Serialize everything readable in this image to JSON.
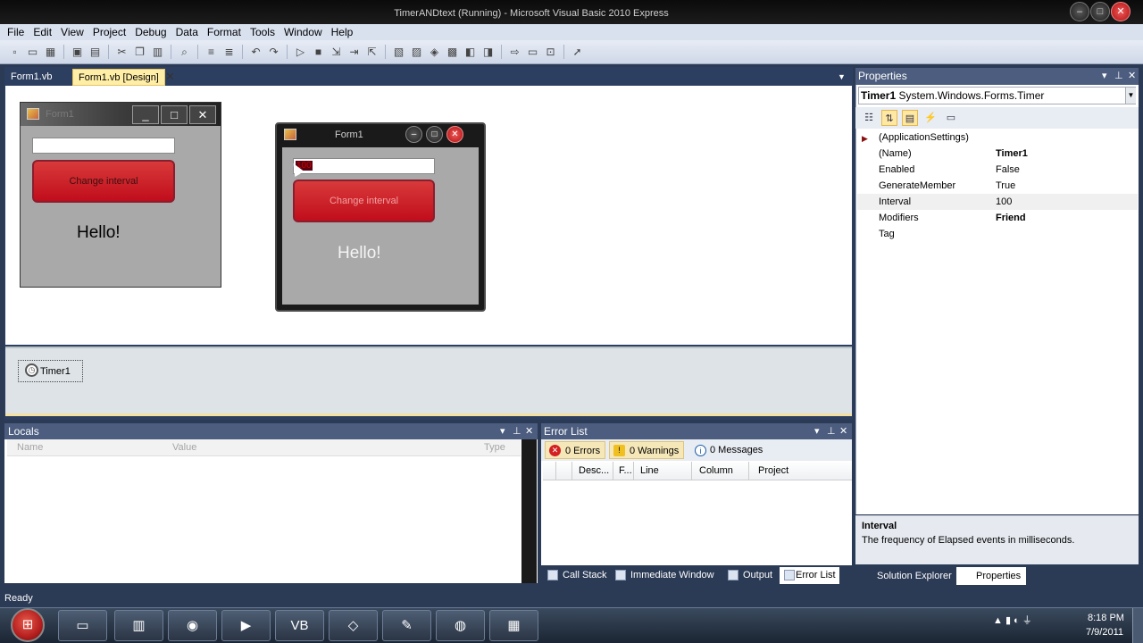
{
  "window": {
    "title": "TimerANDtext (Running) - Microsoft Visual Basic 2010 Express",
    "controls": [
      "–",
      "□",
      "✕"
    ]
  },
  "menu": [
    "File",
    "Edit",
    "View",
    "Project",
    "Debug",
    "Data",
    "Format",
    "Tools",
    "Window",
    "Help"
  ],
  "toolbar_icons": [
    "new-project-icon",
    "open-icon",
    "add-item-icon",
    "save-icon",
    "save-all-icon",
    "cut-icon",
    "copy-icon",
    "paste-icon",
    "find-icon",
    "comment-icon",
    "uncomment-icon",
    "undo-icon",
    "redo-icon",
    "start-debug-icon",
    "stop-icon",
    "step-into-icon",
    "step-over-icon",
    "step-out-icon",
    "solution-explorer-icon",
    "properties-icon",
    "object-browser-icon",
    "toolbox-icon",
    "immediate-icon",
    "error-list-icon",
    "start-page-icon",
    "extension-icon"
  ],
  "doc_tabs": {
    "tab1": "Form1.vb",
    "tab2": "Form1.vb [Design]"
  },
  "design_form": {
    "title": "Form1",
    "button": "Change interval",
    "label": "Hello!"
  },
  "running_form": {
    "title": "Form1",
    "textbox_value": "100",
    "button": "Change interval",
    "label": "Hello!"
  },
  "tray": {
    "component": "Timer1"
  },
  "properties": {
    "header": "Properties",
    "object_name": "Timer1",
    "object_type": "System.Windows.Forms.Timer",
    "rows": [
      {
        "name": "(ApplicationSettings)",
        "value": ""
      },
      {
        "name": "(Name)",
        "value": "Timer1"
      },
      {
        "name": "Enabled",
        "value": "False"
      },
      {
        "name": "GenerateMember",
        "value": "True"
      },
      {
        "name": "Interval",
        "value": "100"
      },
      {
        "name": "Modifiers",
        "value": "Friend"
      },
      {
        "name": "Tag",
        "value": ""
      }
    ],
    "desc_title": "Interval",
    "desc_text": "The frequency of Elapsed events in milliseconds."
  },
  "right_tabs": {
    "solution_explorer": "Solution Explorer",
    "properties": "Properties"
  },
  "locals": {
    "header": "Locals",
    "col_name": "Name",
    "col_value": "Value",
    "col_type": "Type"
  },
  "error_list": {
    "header": "Error List",
    "errors": "0 Errors",
    "warnings": "0 Warnings",
    "messages": "0 Messages",
    "cols": {
      "desc": "Desc...",
      "file": "F...",
      "line": "Line",
      "column": "Column",
      "project": "Project"
    }
  },
  "bottom_tabs": {
    "call_stack": "Call Stack",
    "immediate": "Immediate Window",
    "output": "Output",
    "error_list": "Error List"
  },
  "status": "Ready",
  "clock": {
    "time": "8:18 PM",
    "date": "7/9/2011"
  },
  "colors": {
    "accent": "#4c5d7f",
    "button_red": "#c10d1c",
    "tab_active": "#ffeea6"
  }
}
